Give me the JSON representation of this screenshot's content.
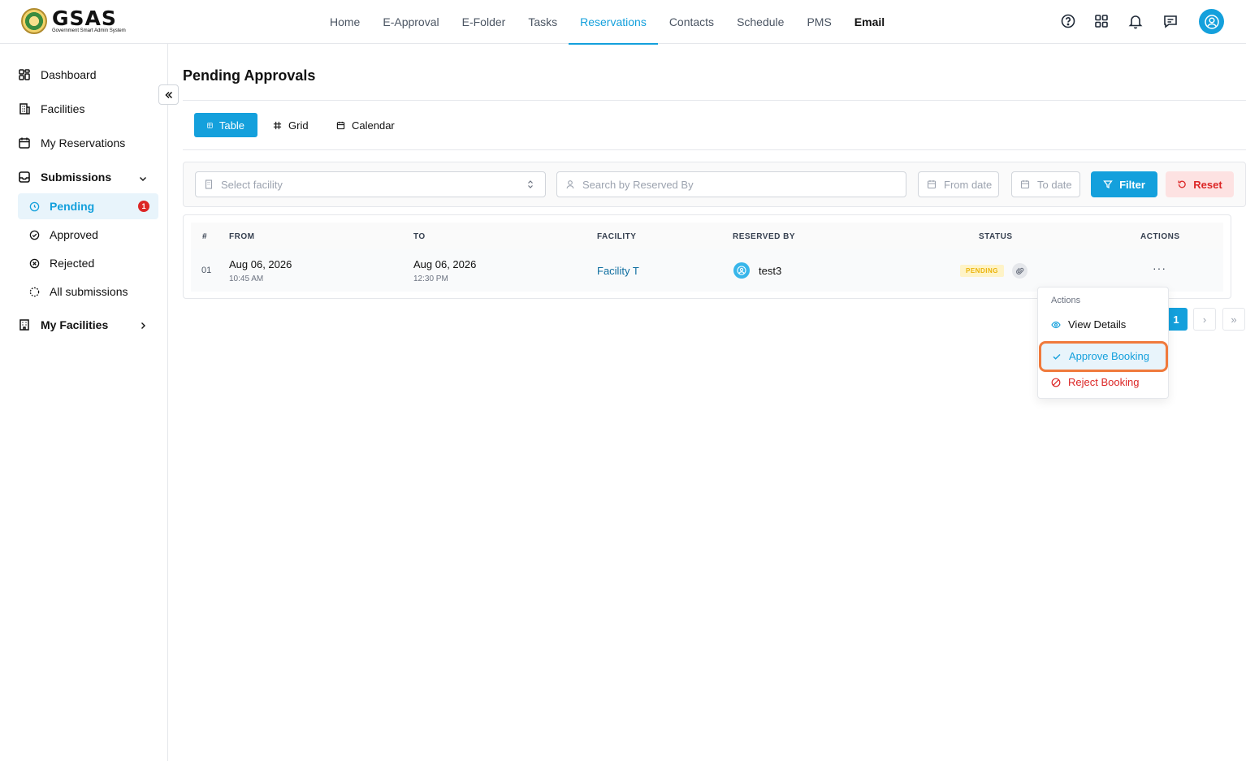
{
  "app": {
    "logo_main": "GSAS",
    "logo_sub": "Government Smart Admin System"
  },
  "nav": {
    "items": [
      {
        "label": "Home"
      },
      {
        "label": "E-Approval"
      },
      {
        "label": "E-Folder"
      },
      {
        "label": "Tasks"
      },
      {
        "label": "Reservations",
        "active": true
      },
      {
        "label": "Contacts"
      },
      {
        "label": "Schedule"
      },
      {
        "label": "PMS"
      },
      {
        "label": "Email"
      }
    ]
  },
  "top_icons": [
    "help-icon",
    "apps-icon",
    "bell-icon",
    "chat-icon",
    "user-avatar-icon"
  ],
  "sidebar": {
    "dashboard": "Dashboard",
    "facilities": "Facilities",
    "my_reservations": "My Reservations",
    "submissions": "Submissions",
    "pending": "Pending",
    "pending_count": "1",
    "approved": "Approved",
    "rejected": "Rejected",
    "all_submissions": "All submissions",
    "my_facilities": "My Facilities"
  },
  "page": {
    "title": "Pending Approvals"
  },
  "views": {
    "table": "Table",
    "grid": "Grid",
    "calendar": "Calendar"
  },
  "filters": {
    "facility_placeholder": "Select facility",
    "search_placeholder": "Search by Reserved By",
    "from_date": "From date",
    "to_date": "To date",
    "filter_button": "Filter",
    "reset_button": "Reset"
  },
  "table": {
    "headers": {
      "num": "#",
      "from": "FROM",
      "to": "TO",
      "facility": "FACILITY",
      "reserved_by": "RESERVED BY",
      "status": "STATUS",
      "actions": "ACTIONS"
    },
    "rows": [
      {
        "num": "01",
        "from_date": "Aug 06, 2026",
        "from_time": "10:45 AM",
        "to_date": "Aug 06, 2026",
        "to_time": "12:30 PM",
        "facility": "Facility T",
        "reserved_by": "test3",
        "status": "PENDING",
        "actions": "···"
      }
    ]
  },
  "pagination": {
    "current": "1",
    "next": "›",
    "last": "»"
  },
  "actions_menu": {
    "heading": "Actions",
    "view": "View Details",
    "approve": "Approve Booking",
    "reject": "Reject Booking"
  },
  "colors": {
    "accent": "#14a0dc",
    "danger": "#dc2626",
    "pending": "#eab308",
    "highlight": "#f07a3c"
  }
}
